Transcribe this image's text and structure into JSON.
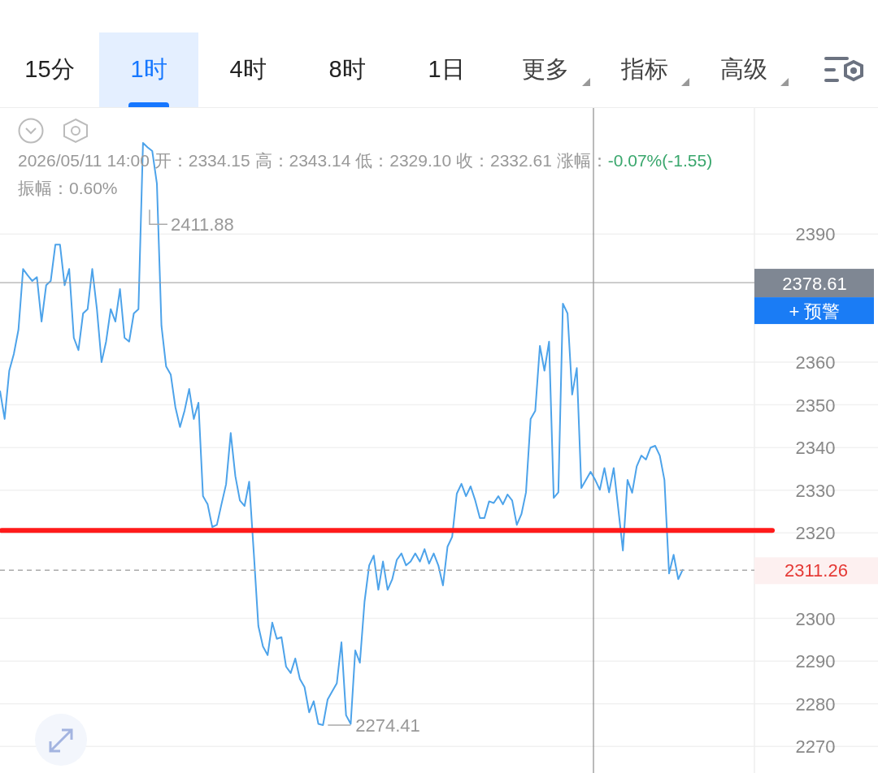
{
  "tabs": [
    {
      "label": "15分",
      "kind": "plain",
      "selected": false
    },
    {
      "label": "1时",
      "kind": "plain",
      "selected": true
    },
    {
      "label": "4时",
      "kind": "plain",
      "selected": false
    },
    {
      "label": "8时",
      "kind": "plain",
      "selected": false
    },
    {
      "label": "1日",
      "kind": "plain",
      "selected": false
    },
    {
      "label": "更多",
      "kind": "dropdown",
      "selected": false
    },
    {
      "label": "指标",
      "kind": "dropdown",
      "selected": false
    },
    {
      "label": "高级",
      "kind": "dropdown",
      "selected": false
    }
  ],
  "chart": {
    "info": {
      "text": "2026/05/11 14:00 开：2334.15 高：2343.14 低：2329.10 收：2332.61 涨幅：",
      "change": "-0.07%(-1.55)",
      "amplitude": "振幅：0.60%"
    },
    "high_label": "2411.88",
    "low_label": "2274.41",
    "alert_button": "+ 预警",
    "chart_data": {
      "type": "line",
      "ylim": [
        2263.6,
        2419.5
      ],
      "yticks": [
        2270,
        2280,
        2290,
        2300,
        2320,
        2330,
        2340,
        2350,
        2360,
        2390
      ],
      "grid": true,
      "series": [
        {
          "color": "#4da3ea",
          "values": [
            2353.3,
            2346.7,
            2358,
            2361.9,
            2367.6,
            2381.8,
            2380.3,
            2379,
            2379.9,
            2369.5,
            2378,
            2379,
            2387.5,
            2387.5,
            2378,
            2381.8,
            2365.7,
            2362.8,
            2371.4,
            2372.4,
            2381.8,
            2372.4,
            2360,
            2364.8,
            2372.4,
            2369.5,
            2377.1,
            2365.7,
            2364.8,
            2371.4,
            2372.4,
            2411.3,
            2410.3,
            2409.4,
            2401.8,
            2368.5,
            2359,
            2357.1,
            2349.5,
            2344.8,
            2348.6,
            2353.7,
            2346.7,
            2350.5,
            2328.6,
            2326.7,
            2321.4,
            2321.9,
            2326.7,
            2331.4,
            2343.4,
            2333.3,
            2327.6,
            2326.3,
            2332,
            2315.3,
            2298.2,
            2293.4,
            2291.4,
            2299,
            2295.2,
            2295.6,
            2288.7,
            2287.2,
            2290.6,
            2285.8,
            2283.9,
            2278,
            2280.6,
            2275.3,
            2275,
            2281,
            2282.9,
            2284.8,
            2294.4,
            2277.3,
            2275.3,
            2292.5,
            2289.6,
            2303.9,
            2312.4,
            2314.7,
            2306.7,
            2313.3,
            2306.7,
            2309.1,
            2313.7,
            2315.2,
            2312.4,
            2313.3,
            2315.2,
            2313.3,
            2316.2,
            2312.8,
            2315.2,
            2312.4,
            2307.7,
            2316.8,
            2319.1,
            2329.2,
            2331.5,
            2328.6,
            2330.9,
            2327.6,
            2323.5,
            2323.5,
            2327.4,
            2327,
            2328.6,
            2326.7,
            2329,
            2327.6,
            2321.9,
            2324.4,
            2329.5,
            2346.7,
            2348.6,
            2363.8,
            2358,
            2364.8,
            2328.2,
            2329.5,
            2373.7,
            2371.4,
            2352.4,
            2358.6,
            2330.5,
            2332.4,
            2334.3,
            2332.4,
            2330.1,
            2335.2,
            2329.5,
            2335.2,
            2325.7,
            2315.9,
            2332.4,
            2329.4,
            2335.6,
            2338.1,
            2337.2,
            2340,
            2340.4,
            2338.1,
            2332.4,
            2310.5,
            2314.9,
            2309.2,
            2311.5
          ]
        }
      ],
      "ref_lines": [
        {
          "axis": "y",
          "value": 2320.6,
          "color": "#ff1a1a"
        },
        {
          "axis": "y",
          "value": 2311.26,
          "color": "#aaaaaa",
          "label": "2311.26"
        },
        {
          "axis": "y",
          "value": 2378.61,
          "color": "#9a9a9a",
          "label": "2378.61"
        }
      ]
    }
  }
}
